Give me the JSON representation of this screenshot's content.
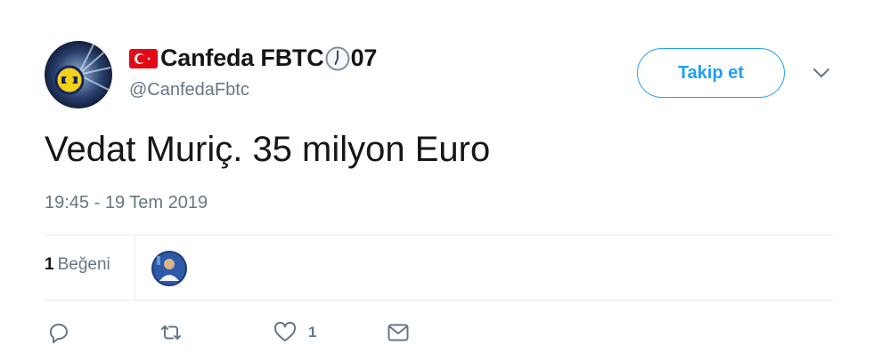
{
  "user": {
    "display_name_main": "Canfeda FBTC",
    "display_name_suffix": "07",
    "handle": "@CanfedaFbtc",
    "flag_icon": "turkey-flag-icon",
    "clock_icon": "clock-icon"
  },
  "follow_label": "Takip et",
  "tweet": {
    "text": "Vedat Muriç. 35 milyon Euro",
    "timestamp": "19:45 - 19 Tem 2019"
  },
  "stats": {
    "likes_count": "1",
    "likes_label": "Beğeni"
  },
  "actions": {
    "reply_icon": "reply-icon",
    "retweet_icon": "retweet-icon",
    "like_icon": "heart-icon",
    "like_count": "1",
    "message_icon": "envelope-icon"
  },
  "colors": {
    "accent": "#1da1f2",
    "text": "#14171a",
    "muted": "#657786",
    "divider": "#e6ecf0"
  }
}
